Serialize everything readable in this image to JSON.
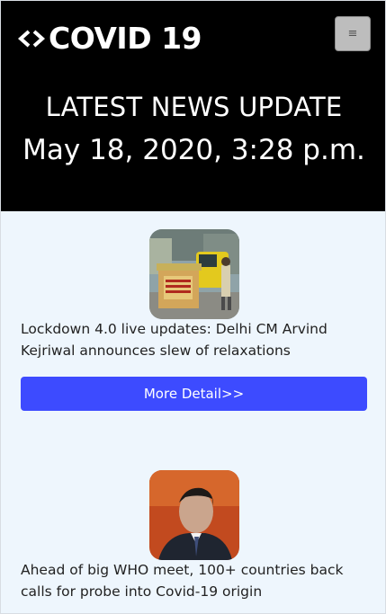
{
  "header": {
    "brand_text": "COVID 19",
    "headline": "LATEST NEWS UPDATE",
    "datetime": "May 18, 2020, 3:28 p.m."
  },
  "menu": {
    "icon": "hamburger-icon"
  },
  "news": [
    {
      "text": "Lockdown 4.0 live updates: Delhi CM Arvind Kejriwal announces slew of relaxations",
      "button_label": "More Detail>>",
      "image": "lockdown-barricade-photo"
    },
    {
      "text": "Ahead of big WHO meet, 100+ countries back calls for probe into Covid-19 origin",
      "image": "xi-jinping-photo"
    }
  ],
  "colors": {
    "header_bg": "#000000",
    "content_bg": "#eef6fd",
    "button_bg": "#3d4bff"
  }
}
